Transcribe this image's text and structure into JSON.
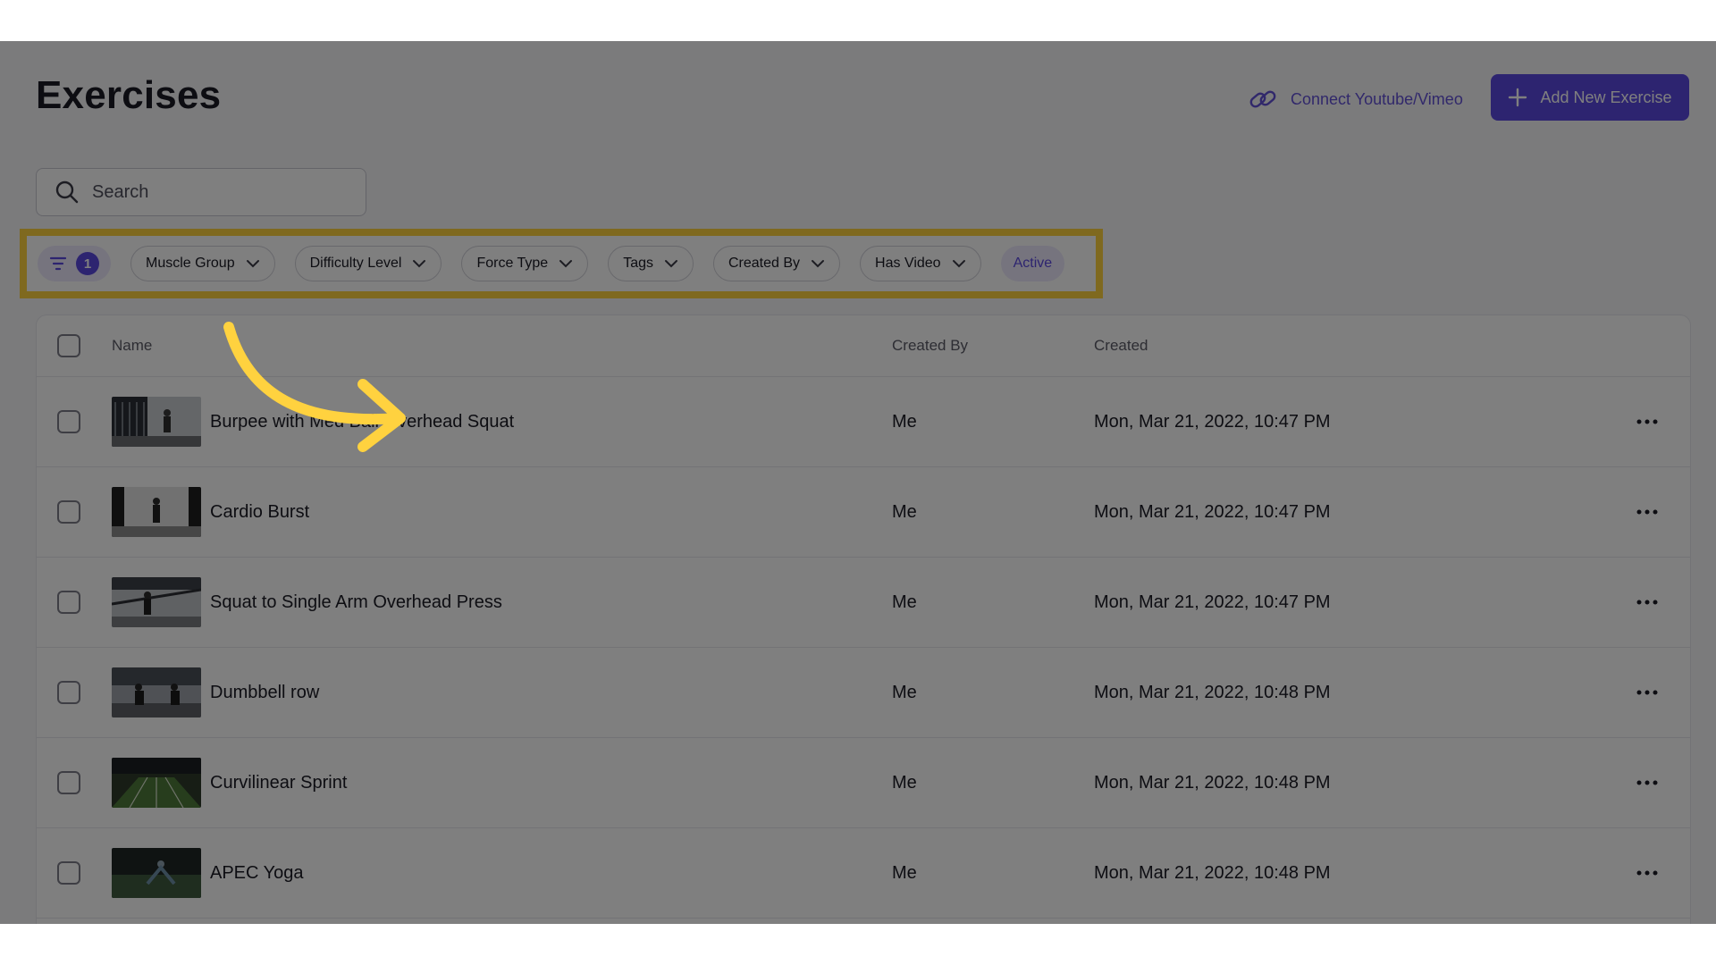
{
  "header": {
    "title": "Exercises",
    "connect_label": "Connect Youtube/Vimeo",
    "add_label": "Add New Exercise"
  },
  "search": {
    "placeholder": "Search",
    "value": ""
  },
  "filters": {
    "active_count": "1",
    "chips": [
      "Muscle Group",
      "Difficulty Level",
      "Force Type",
      "Tags",
      "Created By",
      "Has Video"
    ],
    "active_label": "Active"
  },
  "table": {
    "headers": {
      "name": "Name",
      "created_by": "Created By",
      "created": "Created"
    },
    "rows": [
      {
        "name": "Burpee with Med Ball Overhead Squat",
        "created_by": "Me",
        "created": "Mon, Mar 21, 2022, 10:47 PM"
      },
      {
        "name": "Cardio Burst",
        "created_by": "Me",
        "created": "Mon, Mar 21, 2022, 10:47 PM"
      },
      {
        "name": "Squat to Single Arm Overhead Press",
        "created_by": "Me",
        "created": "Mon, Mar 21, 2022, 10:47 PM"
      },
      {
        "name": "Dumbbell row",
        "created_by": "Me",
        "created": "Mon, Mar 21, 2022, 10:48 PM"
      },
      {
        "name": "Curvilinear Sprint",
        "created_by": "Me",
        "created": "Mon, Mar 21, 2022, 10:48 PM"
      },
      {
        "name": "APEC Yoga",
        "created_by": "Me",
        "created": "Mon, Mar 21, 2022, 10:48 PM"
      }
    ]
  },
  "colors": {
    "accent": "#5b48e0",
    "highlight": "#ffd23f",
    "chip_active_bg": "#ece8fc"
  },
  "icons": [
    "link-icon",
    "plus-icon",
    "search-icon",
    "filter-icon",
    "chevron-down-icon",
    "more-icon",
    "arrow-annotation"
  ]
}
